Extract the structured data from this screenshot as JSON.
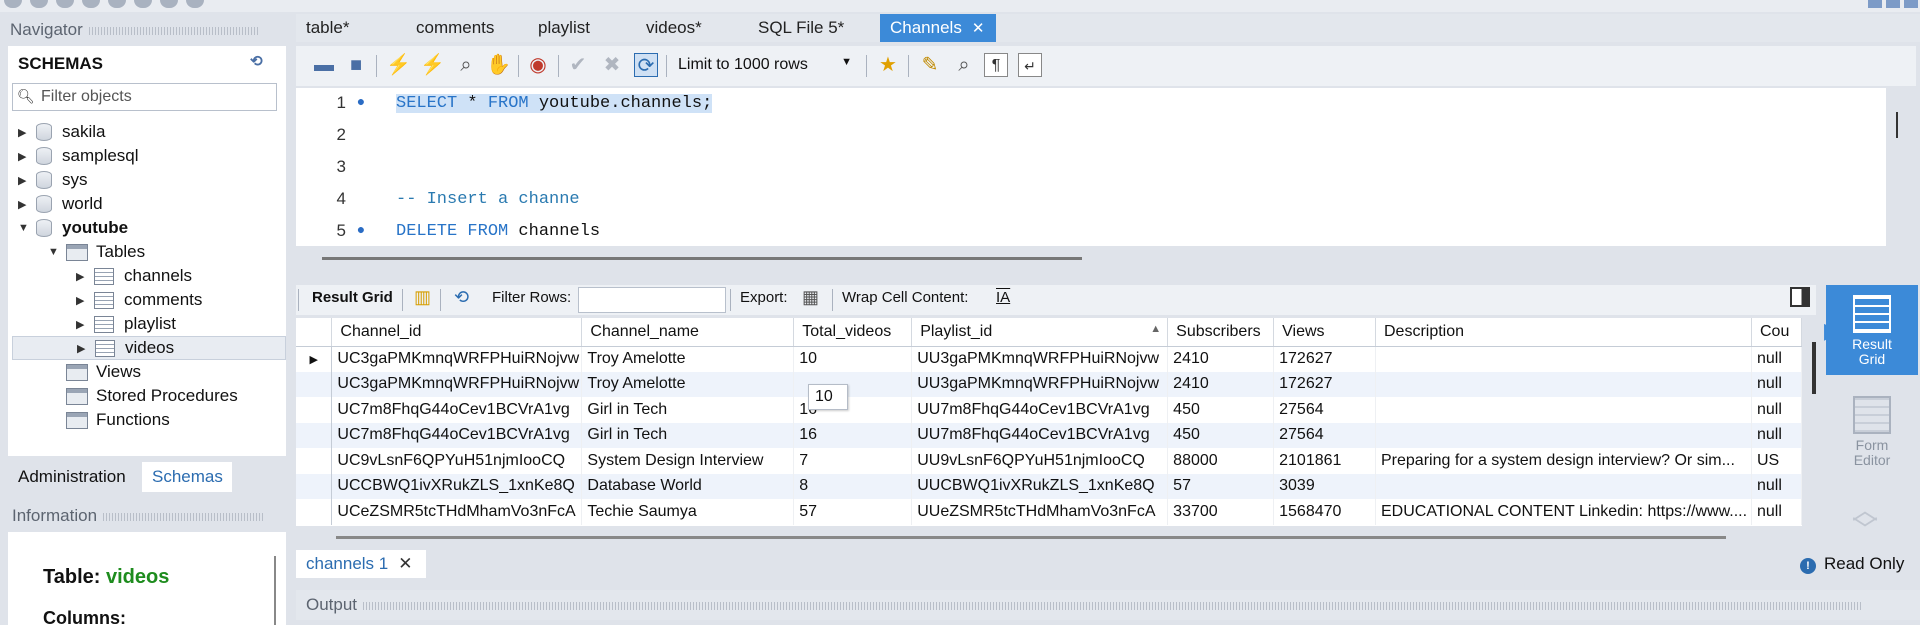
{
  "navigator": {
    "header": "Navigator",
    "schemas_title": "SCHEMAS",
    "filter_placeholder": "Filter objects",
    "schemas": [
      "sakila",
      "samplesql",
      "sys",
      "world"
    ],
    "active_schema": "youtube",
    "tables_label": "Tables",
    "tables": [
      "channels",
      "comments",
      "playlist",
      "videos"
    ],
    "views": "Views",
    "stored_procedures": "Stored Procedures",
    "functions": "Functions",
    "tab_admin": "Administration",
    "tab_schemas": "Schemas",
    "info_header": "Information",
    "info_table_prefix": "Table:",
    "info_table_name": "videos",
    "info_columns": "Columns:"
  },
  "editor_tabs": [
    {
      "label": "table*"
    },
    {
      "label": "comments"
    },
    {
      "label": "playlist"
    },
    {
      "label": "videos*"
    },
    {
      "label": "SQL File 5*"
    },
    {
      "label": "Channels"
    }
  ],
  "toolbar": {
    "limit": "Limit to 1000 rows"
  },
  "editor": {
    "lines": [
      {
        "n": "1",
        "bullet": "●",
        "kw1": "SELECT",
        "mid": " * ",
        "kw2": "FROM",
        "rest": " youtube.channels;"
      },
      {
        "n": "2"
      },
      {
        "n": "3"
      },
      {
        "n": "4",
        "comment": "-- Insert a channe"
      },
      {
        "n": "5",
        "bullet": "●",
        "kw1": "DELETE",
        "mid": " ",
        "kw2": "FROM",
        "rest": " channels"
      }
    ]
  },
  "result_toolbar": {
    "result_grid": "Result Grid",
    "filter_rows": "Filter Rows:",
    "export": "Export:",
    "wrap": "Wrap Cell Content:"
  },
  "grid": {
    "columns": [
      "Channel_id",
      "Channel_name",
      "Total_videos",
      "Playlist_id",
      "Subscribers",
      "Views",
      "Description",
      "Cou"
    ],
    "rows": [
      [
        "UC3gaPMKmnqWRFPHuiRNojvw",
        "Troy Amelotte",
        "10",
        "UU3gaPMKmnqWRFPHuiRNojvw",
        "2410",
        "172627",
        "",
        "null"
      ],
      [
        "UC3gaPMKmnqWRFPHuiRNojvw",
        "Troy Amelotte",
        "",
        "UU3gaPMKmnqWRFPHuiRNojvw",
        "2410",
        "172627",
        "",
        "null"
      ],
      [
        "UC7m8FhqG44oCev1BCVrA1vg",
        "Girl in Tech",
        "16",
        "UU7m8FhqG44oCev1BCVrA1vg",
        "450",
        "27564",
        "",
        "null"
      ],
      [
        "UC7m8FhqG44oCev1BCVrA1vg",
        "Girl in Tech",
        "16",
        "UU7m8FhqG44oCev1BCVrA1vg",
        "450",
        "27564",
        "",
        "null"
      ],
      [
        "UC9vLsnF6QPYuH51njmIooCQ",
        "System Design Interview",
        "7",
        "UU9vLsnF6QPYuH51njmIooCQ",
        "88000",
        "2101861",
        "Preparing for a system design interview? Or sim...",
        "US"
      ],
      [
        "UCCBWQ1ivXRukZLS_1xnKe8Q",
        "Database World",
        "8",
        "UUCBWQ1ivXRukZLS_1xnKe8Q",
        "57",
        "3039",
        "",
        "null"
      ],
      [
        "UCeZSMR5tcTHdMhamVo3nFcA",
        "Techie Saumya",
        "57",
        "UUeZSMR5tcTHdMhamVo3nFcA",
        "33700",
        "1568470",
        "EDUCATIONAL CONTENT Linkedin: https://www....",
        "null"
      ]
    ],
    "tooltip": "10"
  },
  "side": {
    "result_grid": [
      "Result",
      "Grid"
    ],
    "form_editor": [
      "Form",
      "Editor"
    ]
  },
  "bottom": {
    "result_tab": "channels 1",
    "read_only": "Read Only",
    "output": "Output"
  },
  "colors": {
    "accent": "#3c8ad8",
    "green": "#1e8c1e"
  }
}
